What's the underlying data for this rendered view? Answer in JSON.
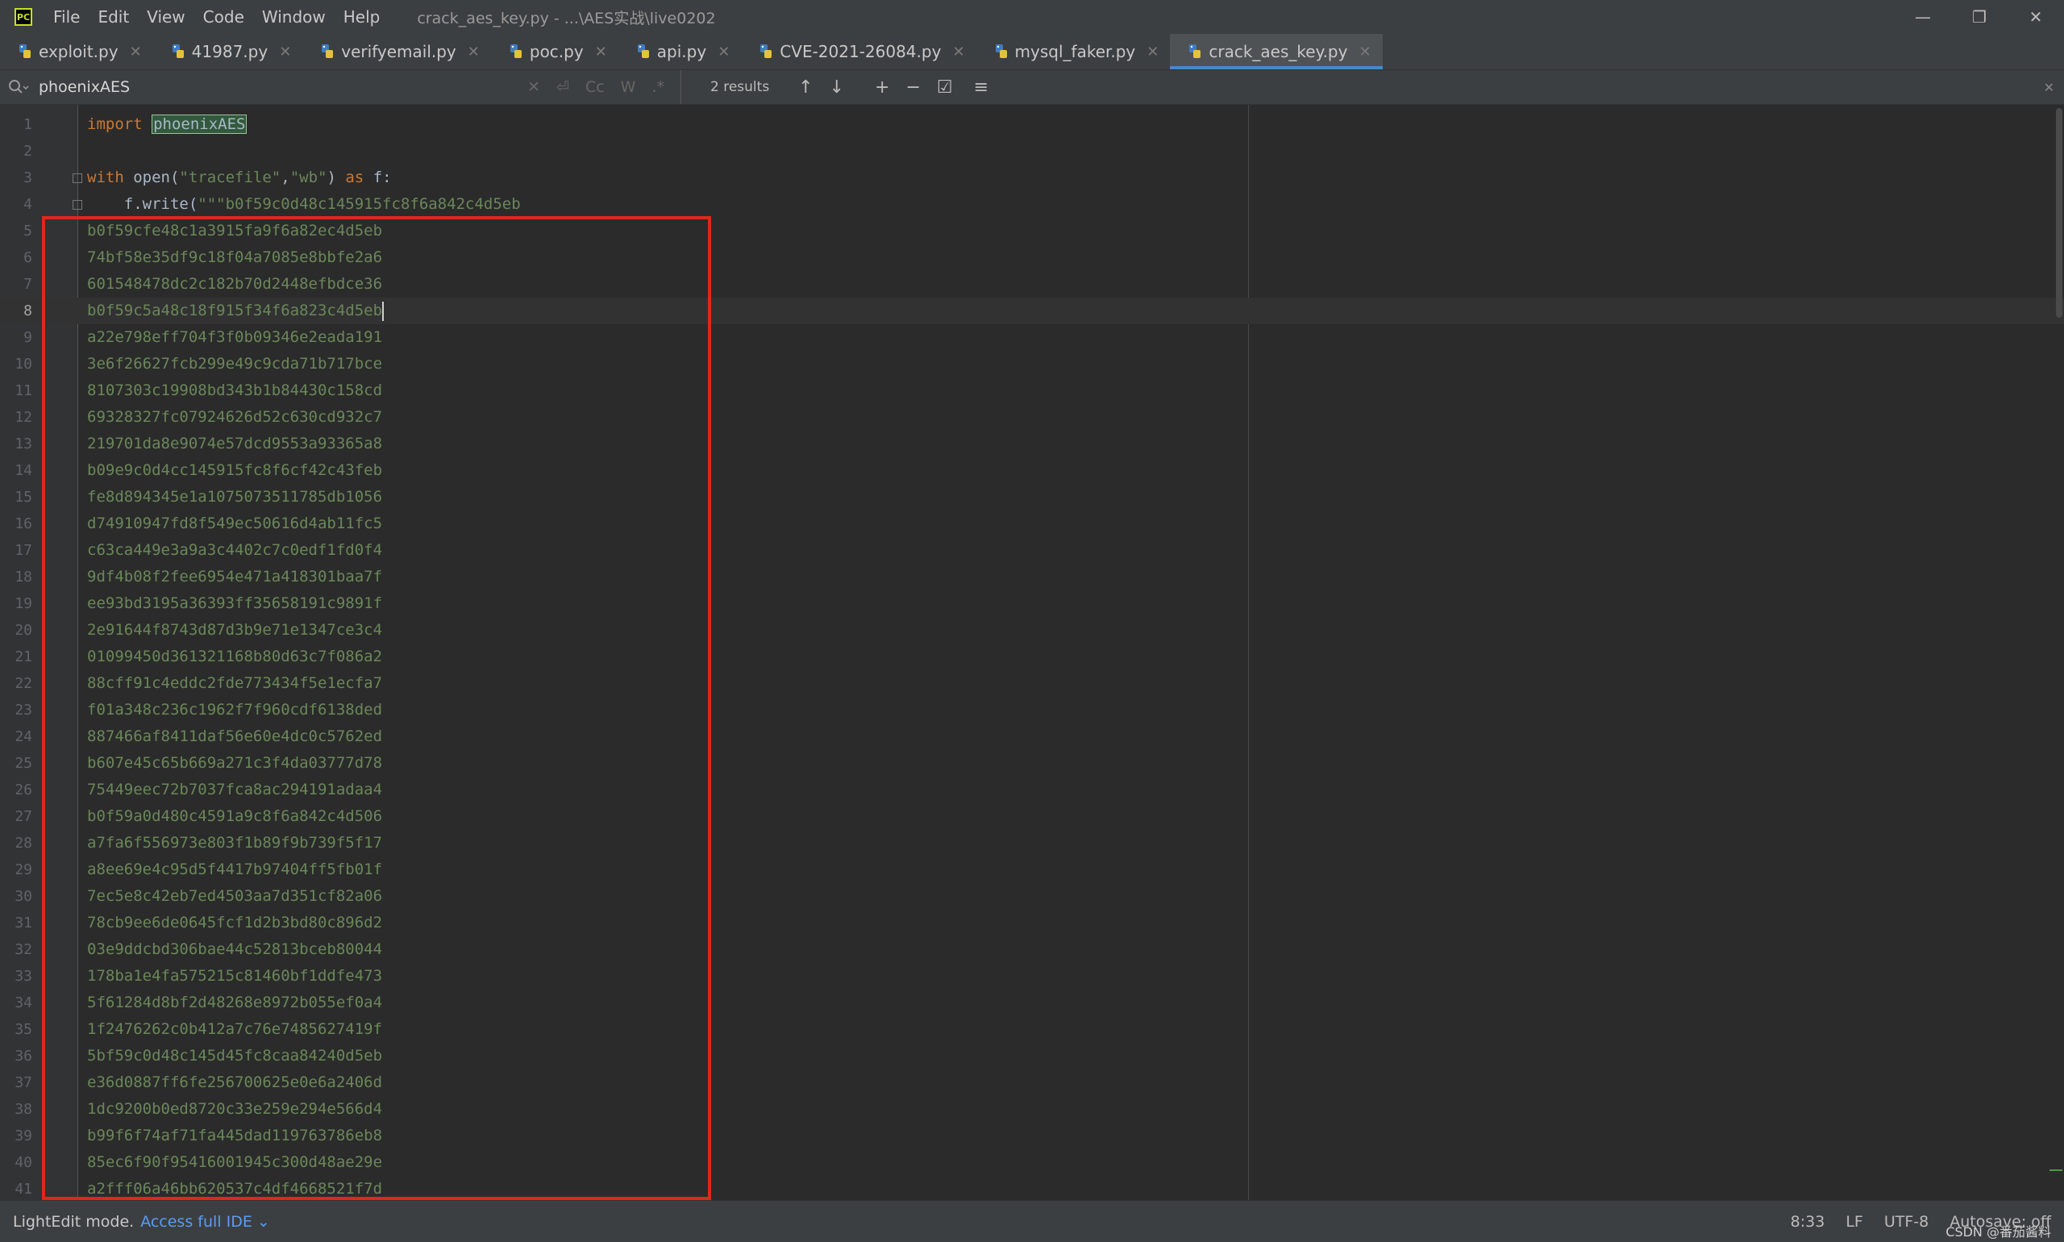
{
  "titlebar": {
    "logo": "PC",
    "menu": [
      "File",
      "Edit",
      "View",
      "Code",
      "Window",
      "Help"
    ],
    "window_title": "crack_aes_key.py - ...\\AES实战\\live0202",
    "controls": [
      "—",
      "❐",
      "✕"
    ]
  },
  "tabs": [
    {
      "label": "exploit.py",
      "active": false
    },
    {
      "label": "41987.py",
      "active": false
    },
    {
      "label": "verifyemail.py",
      "active": false
    },
    {
      "label": "poc.py",
      "active": false
    },
    {
      "label": "api.py",
      "active": false
    },
    {
      "label": "CVE-2021-26084.py",
      "active": false
    },
    {
      "label": "mysql_faker.py",
      "active": false
    },
    {
      "label": "crack_aes_key.py",
      "active": true
    }
  ],
  "search": {
    "query": "phoenixAES",
    "tools": [
      "Cc",
      "W",
      ".*"
    ],
    "results": "2 results"
  },
  "editor": {
    "current_line": 8,
    "line1": {
      "kw": "import",
      "module": "phoenixAES"
    },
    "line3": {
      "kw1": "with",
      "call": " open(",
      "arg1": "\"tracefile\"",
      "comma": ",",
      "arg2": "\"wb\"",
      "close": ") ",
      "kw2": "as",
      "rest": " f:"
    },
    "line4": {
      "prefix": "    f.write(",
      "str": "\"\"\"b0f59c0d48c145915fc8f6a842c4d5eb"
    },
    "hex_lines": [
      "b0f59cfe48c1a3915fa9f6a82ec4d5eb",
      "74bf58e35df9c18f04a7085e8bbfe2a6",
      "601548478dc2c182b70d2448efbdce36",
      "b0f59c5a48c18f915f34f6a823c4d5eb",
      "a22e798eff704f3f0b09346e2eada191",
      "3e6f26627fcb299e49c9cda71b717bce",
      "8107303c19908bd343b1b84430c158cd",
      "69328327fc07924626d52c630cd932c7",
      "219701da8e9074e57dcd9553a93365a8",
      "b09e9c0d4cc145915fc8f6cf42c43feb",
      "fe8d894345e1a1075073511785db1056",
      "d74910947fd8f549ec50616d4ab11fc5",
      "c63ca449e3a9a3c4402c7c0edf1fd0f4",
      "9df4b08f2fee6954e471a418301baa7f",
      "ee93bd3195a36393ff35658191c9891f",
      "2e91644f8743d87d3b9e71e1347ce3c4",
      "01099450d361321168b80d63c7f086a2",
      "88cff91c4eddc2fde773434f5e1ecfa7",
      "f01a348c236c1962f7f960cdf6138ded",
      "887466af8411daf56e60e4dc0c5762ed",
      "b607e45c65b669a271c3f4da03777d78",
      "75449eec72b7037fca8ac294191adaa4",
      "b0f59a0d480c4591a9c8f6a842c4d506",
      "a7fa6f556973e803f1b89f9b739f5f17",
      "a8ee69e4c95d5f4417b97404ff5fb01f",
      "7ec5e8c42eb7ed4503aa7d351cf82a06",
      "78cb9ee6de0645fcf1d2b3bd80c896d2",
      "03e9ddcbd306bae44c52813bceb80044",
      "178ba1e4fa575215c81460bf1ddfe473",
      "5f61284d8bf2d48268e8972b055ef0a4",
      "1f2476262c0b412a7c76e7485627419f",
      "5bf59c0d48c145d45fc8caa84240d5eb",
      "e36d0887ff6fe256700625e0e6a2406d",
      "1dc9200b0ed8720c33e259e294e566d4",
      "b99f6f74af71fa445dad119763786eb8",
      "85ec6f90f95416001945c300d48ae29e",
      "a2fff06a46bb620537c4df4668521f7d"
    ]
  },
  "status": {
    "mode": "LightEdit mode.",
    "link": "Access full IDE ⌄",
    "position": "8:33",
    "line_sep": "LF",
    "encoding": "UTF-8",
    "autosave": "Autosave: off",
    "watermark": "CSDN @番茄酱料"
  }
}
